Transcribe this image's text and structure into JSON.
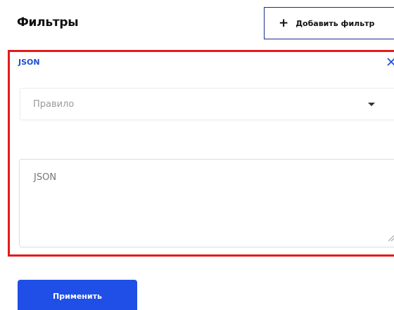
{
  "header": {
    "title": "Фильтры",
    "add_filter_label": "Добавить фильтр",
    "add_icon": "plus-icon"
  },
  "filter": {
    "label": "JSON",
    "close_icon": "close-icon",
    "rule_select": {
      "placeholder": "Правило",
      "icon": "chevron-down-icon"
    },
    "json_field": {
      "placeholder": "JSON",
      "value": ""
    }
  },
  "footer": {
    "apply_label": "Применить"
  },
  "colors": {
    "accent": "#1f4fe6",
    "highlight_border": "#e41b1b",
    "label_blue": "#1d4fd6"
  }
}
